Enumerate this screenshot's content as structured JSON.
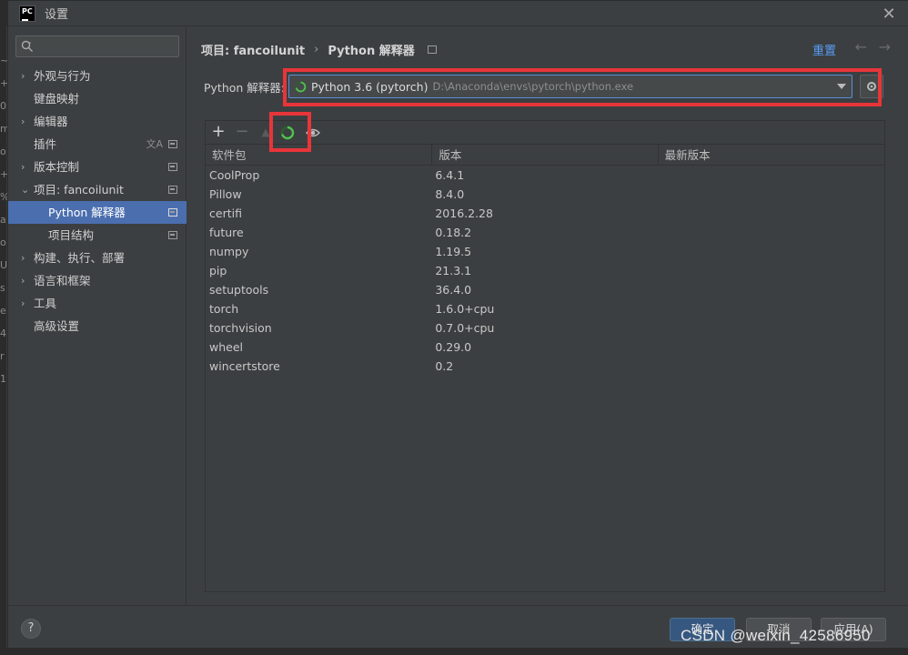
{
  "window": {
    "title": "设置",
    "close_label": "✕",
    "logo_text": "PC"
  },
  "edge_chars": [
    "~",
    "+",
    "0",
    "m",
    "o",
    "+",
    "%",
    "a",
    "o",
    "U",
    "s",
    "e",
    "4",
    "r",
    "1"
  ],
  "sidebar": {
    "search_placeholder": "",
    "items": [
      {
        "label": "外观与行为",
        "chevron": "›"
      },
      {
        "label": "键盘映射",
        "chevron": ""
      },
      {
        "label": "编辑器",
        "chevron": "›"
      },
      {
        "label": "插件",
        "chevron": "",
        "extra": "文A"
      },
      {
        "label": "版本控制",
        "chevron": "›"
      },
      {
        "label": "项目: fancoilunit",
        "chevron": "⌄"
      },
      {
        "label": "Python 解释器",
        "chevron": "",
        "selected": true
      },
      {
        "label": "项目结构",
        "chevron": ""
      },
      {
        "label": "构建、执行、部署",
        "chevron": "›"
      },
      {
        "label": "语言和框架",
        "chevron": "›"
      },
      {
        "label": "工具",
        "chevron": "›"
      },
      {
        "label": "高级设置",
        "chevron": ""
      }
    ]
  },
  "header": {
    "breadcrumb_project": "项目: fancoilunit",
    "breadcrumb_sep": "›",
    "breadcrumb_page": "Python 解释器",
    "reset_label": "重置",
    "back_arrow": "←",
    "forward_arrow": "→"
  },
  "interpreter": {
    "label": "Python 解释器:",
    "name": "Python 3.6 (pytorch)",
    "path": "D:\\Anaconda\\envs\\pytorch\\python.exe"
  },
  "toolbar": {
    "add": "+",
    "remove": "−",
    "upgrade": "▲"
  },
  "table": {
    "columns": [
      "软件包",
      "版本",
      "最新版本"
    ],
    "rows": [
      [
        "CoolProp",
        "6.4.1",
        ""
      ],
      [
        "Pillow",
        "8.4.0",
        ""
      ],
      [
        "certifi",
        "2016.2.28",
        ""
      ],
      [
        "future",
        "0.18.2",
        ""
      ],
      [
        "numpy",
        "1.19.5",
        ""
      ],
      [
        "pip",
        "21.3.1",
        ""
      ],
      [
        "setuptools",
        "36.4.0",
        ""
      ],
      [
        "torch",
        "1.6.0+cpu",
        ""
      ],
      [
        "torchvision",
        "0.7.0+cpu",
        ""
      ],
      [
        "wheel",
        "0.29.0",
        ""
      ],
      [
        "wincertstore",
        "0.2",
        ""
      ]
    ]
  },
  "footer": {
    "help": "?",
    "ok": "确定",
    "cancel": "取消",
    "apply": "应用(A)"
  },
  "watermark": "CSDN @weixin_42586950",
  "colors": {
    "accent": "#4b6eaf",
    "link": "#589df6",
    "highlight": "#e8353a",
    "spinner": "#4fc14f"
  }
}
